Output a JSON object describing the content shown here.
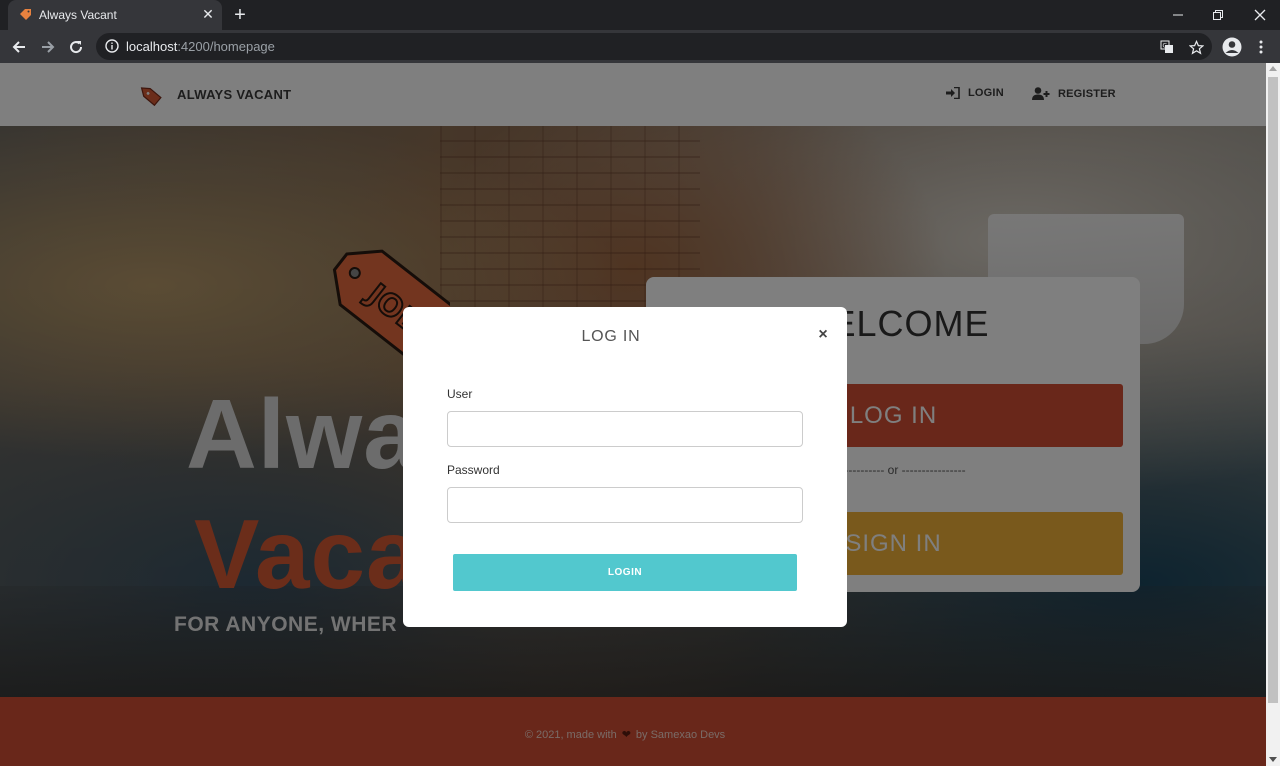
{
  "browser": {
    "tab_title": "Always Vacant",
    "url_host": "localhost",
    "url_path": ":4200/homepage"
  },
  "navbar": {
    "brand": "ALWAYS VACANT",
    "login_label": "LOGIN",
    "register_label": "REGISTER"
  },
  "hero": {
    "title_line1": "Alwa",
    "title_line2": "Vaca",
    "subtitle": "FOR ANYONE, WHER",
    "tag_text": "JOB"
  },
  "welcome": {
    "title": "WELCOME",
    "login_label": "LOG IN",
    "separator": "---------------- or ----------------",
    "signin_label": "SIGN IN"
  },
  "modal": {
    "title": "LOG IN",
    "close_label": "×",
    "user_label": "User",
    "user_value": "",
    "password_label": "Password",
    "password_value": "",
    "login_button": "LOGIN"
  },
  "footer": {
    "prefix": "© 2021, made with",
    "suffix": "by Samexao Devs"
  },
  "colors": {
    "primary_red": "#d24f34",
    "accent_yellow": "#f2b338",
    "button_teal": "#52c8ce"
  },
  "icons": [
    "tag-favicon-icon",
    "close-tab-icon",
    "new-tab-icon",
    "back-icon",
    "forward-icon",
    "reload-icon",
    "info-icon",
    "translate-icon",
    "star-icon",
    "profile-icon",
    "menu-icon",
    "login-icon",
    "user-plus-icon",
    "heart-icon"
  ]
}
